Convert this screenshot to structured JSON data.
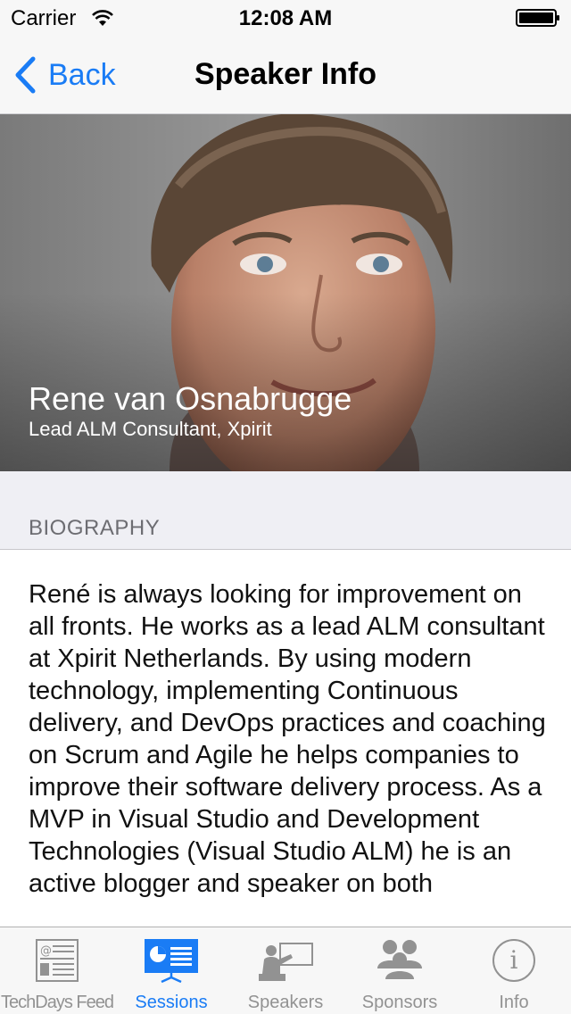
{
  "status_bar": {
    "carrier": "Carrier",
    "time": "12:08 AM"
  },
  "nav": {
    "back_label": "Back",
    "title": "Speaker Info"
  },
  "speaker": {
    "name": "Rene van Osnabrugge",
    "title": "Lead ALM Consultant, Xpirit"
  },
  "section": {
    "header": "BIOGRAPHY"
  },
  "biography": "René is always looking for improvement on all fronts. He works as a lead ALM consultant at Xpirit Netherlands. By using modern technology, implementing Continuous delivery, and DevOps practices and coaching on Scrum and Agile he helps companies to improve their software delivery process. As a MVP in Visual Studio and Development Technologies (Visual Studio ALM) he is an active blogger and speaker on both",
  "tabs": [
    {
      "label": "TechDays Feed",
      "icon": "newspaper-icon"
    },
    {
      "label": "Sessions",
      "icon": "presentation-icon",
      "active": true
    },
    {
      "label": "Speakers",
      "icon": "speaker-podium-icon"
    },
    {
      "label": "Sponsors",
      "icon": "group-icon"
    },
    {
      "label": "Info",
      "icon": "info-icon"
    }
  ],
  "colors": {
    "accent": "#1a7cf5",
    "inactive": "#929292",
    "bar_bg": "#f7f7f7",
    "section_bg": "#efeff4"
  }
}
